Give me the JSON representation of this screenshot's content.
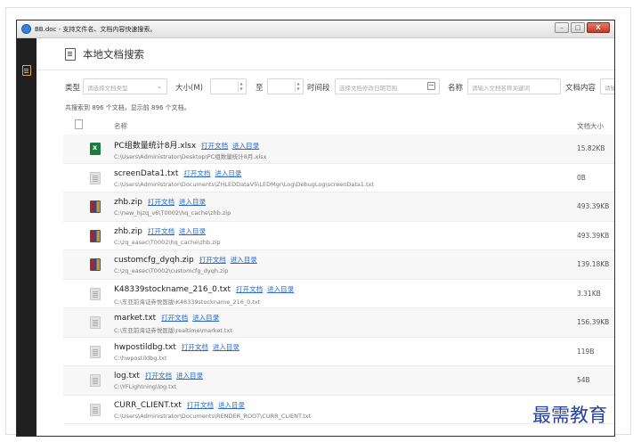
{
  "window": {
    "title": "BB.doc - 支持文件名、文档内容快速搜索。",
    "buttons": [
      "–",
      "□",
      "X"
    ]
  },
  "header": {
    "title": "本地文档搜索"
  },
  "filters": {
    "type_label": "类型",
    "type_placeholder": "请选择文档类型",
    "size_label": "大小(M)",
    "size_to": "至",
    "time_label": "时间段",
    "time_placeholder": "选择文档修改日期范围",
    "name_label": "名称",
    "name_placeholder": "请输入文档名称关键词",
    "content_label": "文档内容",
    "content_placeholder": "请输..."
  },
  "summary": "共搜索到 896 个文档，显示前 896 个文档。",
  "table": {
    "col_name": "名称",
    "col_size": "文档大小",
    "open_label": "打开文档",
    "folder_label": "进入目录",
    "rows": [
      {
        "name": "PC组数量统计8月.xlsx",
        "path": "C:\\Users\\Administrator\\Desktop\\PC组数量统计8月.xlsx",
        "size": "15.82KB",
        "icon": "excel-icon"
      },
      {
        "name": "screenData1.txt",
        "path": "C:\\Users\\Administrator\\Documents\\ZHLEDDataV5\\LEDMgr\\Log\\DebugLog\\screenData1.txt",
        "size": "0B",
        "icon": "text-file-icon"
      },
      {
        "name": "zhb.zip",
        "path": "C:\\new_hjzq_v6\\T0002\\hq_cache\\zhb.zip",
        "size": "493.39KB",
        "icon": "zip-icon"
      },
      {
        "name": "zhb.zip",
        "path": "C:\\zq_easec\\T0002\\hq_cache\\zhb.zip",
        "size": "493.39KB",
        "icon": "zip-icon"
      },
      {
        "name": "customcfg_dyqh.zip",
        "path": "C:\\zq_easec\\T0002\\customcfg_dyqh.zip",
        "size": "139.18KB",
        "icon": "zip-icon"
      },
      {
        "name": "K48339stockname_216_0.txt",
        "path": "C:\\东亚前海证券悦医版\\K48339stockname_216_0.txt",
        "size": "3.31KB",
        "icon": "text-file-icon"
      },
      {
        "name": "market.txt",
        "path": "C:\\东亚前海证券悦医版\\realtime\\market.txt",
        "size": "156.39KB",
        "icon": "text-file-icon"
      },
      {
        "name": "hwpostildbg.txt",
        "path": "C:\\hwpostildbg.txt",
        "size": "119B",
        "icon": "text-file-icon"
      },
      {
        "name": "log.txt",
        "path": "C:\\YFLightning\\log.txt",
        "size": "54B",
        "icon": "text-file-icon"
      },
      {
        "name": "CURR_CLIENT.txt",
        "path": "C:\\Users\\Administrator\\Documents\\RENDER_ROOT\\CURR_CLIENT.txt",
        "size": "",
        "icon": "text-file-icon"
      }
    ]
  },
  "watermark": "最需教育",
  "colors": {
    "link": "#2a6bd1",
    "sidebar": "#202020",
    "accent": "#e8a33d"
  }
}
